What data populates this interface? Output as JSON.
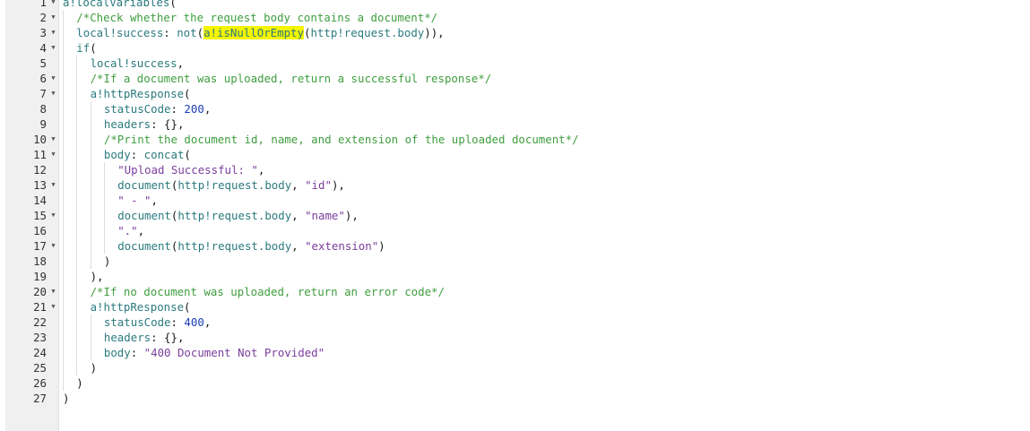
{
  "editor": {
    "lines": [
      {
        "num": "1",
        "fold": true,
        "indent": 0,
        "tokens": [
          {
            "t": "k",
            "v": "a!localVariables"
          },
          {
            "t": "p",
            "v": "("
          }
        ]
      },
      {
        "num": "2",
        "fold": true,
        "indent": 1,
        "tokens": [
          {
            "t": "c",
            "v": "/*Check whether the request body contains a document*/"
          }
        ]
      },
      {
        "num": "3",
        "fold": true,
        "indent": 1,
        "tokens": [
          {
            "t": "k",
            "v": "local!success"
          },
          {
            "t": "p",
            "v": ": "
          },
          {
            "t": "k",
            "v": "not"
          },
          {
            "t": "p",
            "v": "("
          },
          {
            "t": "k",
            "v": "a!isNullOrEmpty",
            "hl": true
          },
          {
            "t": "p",
            "v": "("
          },
          {
            "t": "k",
            "v": "http!request.body"
          },
          {
            "t": "p",
            "v": ")),"
          }
        ]
      },
      {
        "num": "4",
        "fold": true,
        "indent": 1,
        "tokens": [
          {
            "t": "k",
            "v": "if"
          },
          {
            "t": "p",
            "v": "("
          }
        ]
      },
      {
        "num": "5",
        "fold": false,
        "indent": 2,
        "tokens": [
          {
            "t": "k",
            "v": "local!success"
          },
          {
            "t": "p",
            "v": ","
          }
        ]
      },
      {
        "num": "6",
        "fold": true,
        "indent": 2,
        "tokens": [
          {
            "t": "c",
            "v": "/*If a document was uploaded, return a successful response*/"
          }
        ]
      },
      {
        "num": "7",
        "fold": true,
        "indent": 2,
        "tokens": [
          {
            "t": "k",
            "v": "a!httpResponse"
          },
          {
            "t": "p",
            "v": "("
          }
        ]
      },
      {
        "num": "8",
        "fold": false,
        "indent": 3,
        "tokens": [
          {
            "t": "k",
            "v": "statusCode"
          },
          {
            "t": "p",
            "v": ": "
          },
          {
            "t": "n",
            "v": "200"
          },
          {
            "t": "p",
            "v": ","
          }
        ]
      },
      {
        "num": "9",
        "fold": false,
        "indent": 3,
        "tokens": [
          {
            "t": "k",
            "v": "headers"
          },
          {
            "t": "p",
            "v": ": {},"
          }
        ]
      },
      {
        "num": "10",
        "fold": true,
        "indent": 3,
        "tokens": [
          {
            "t": "c",
            "v": "/*Print the document id, name, and extension of the uploaded document*/"
          }
        ]
      },
      {
        "num": "11",
        "fold": true,
        "indent": 3,
        "tokens": [
          {
            "t": "k",
            "v": "body"
          },
          {
            "t": "p",
            "v": ": "
          },
          {
            "t": "k",
            "v": "concat"
          },
          {
            "t": "p",
            "v": "("
          }
        ]
      },
      {
        "num": "12",
        "fold": false,
        "indent": 4,
        "tokens": [
          {
            "t": "s",
            "v": "\"Upload Successful: \""
          },
          {
            "t": "p",
            "v": ","
          }
        ]
      },
      {
        "num": "13",
        "fold": true,
        "indent": 4,
        "tokens": [
          {
            "t": "k",
            "v": "document"
          },
          {
            "t": "p",
            "v": "("
          },
          {
            "t": "k",
            "v": "http!request.body"
          },
          {
            "t": "p",
            "v": ", "
          },
          {
            "t": "s",
            "v": "\"id\""
          },
          {
            "t": "p",
            "v": "),"
          }
        ]
      },
      {
        "num": "14",
        "fold": false,
        "indent": 4,
        "tokens": [
          {
            "t": "s",
            "v": "\" - \""
          },
          {
            "t": "p",
            "v": ","
          }
        ]
      },
      {
        "num": "15",
        "fold": true,
        "indent": 4,
        "tokens": [
          {
            "t": "k",
            "v": "document"
          },
          {
            "t": "p",
            "v": "("
          },
          {
            "t": "k",
            "v": "http!request.body"
          },
          {
            "t": "p",
            "v": ", "
          },
          {
            "t": "s",
            "v": "\"name\""
          },
          {
            "t": "p",
            "v": "),"
          }
        ]
      },
      {
        "num": "16",
        "fold": false,
        "indent": 4,
        "tokens": [
          {
            "t": "s",
            "v": "\".\""
          },
          {
            "t": "p",
            "v": ","
          }
        ]
      },
      {
        "num": "17",
        "fold": true,
        "indent": 4,
        "tokens": [
          {
            "t": "k",
            "v": "document"
          },
          {
            "t": "p",
            "v": "("
          },
          {
            "t": "k",
            "v": "http!request.body"
          },
          {
            "t": "p",
            "v": ", "
          },
          {
            "t": "s",
            "v": "\"extension\""
          },
          {
            "t": "p",
            "v": ")"
          }
        ]
      },
      {
        "num": "18",
        "fold": false,
        "indent": 3,
        "tokens": [
          {
            "t": "p",
            "v": ")"
          }
        ]
      },
      {
        "num": "19",
        "fold": false,
        "indent": 2,
        "tokens": [
          {
            "t": "p",
            "v": "),"
          }
        ]
      },
      {
        "num": "20",
        "fold": true,
        "indent": 2,
        "tokens": [
          {
            "t": "c",
            "v": "/*If no document was uploaded, return an error code*/"
          }
        ]
      },
      {
        "num": "21",
        "fold": true,
        "indent": 2,
        "tokens": [
          {
            "t": "k",
            "v": "a!httpResponse"
          },
          {
            "t": "p",
            "v": "("
          }
        ]
      },
      {
        "num": "22",
        "fold": false,
        "indent": 3,
        "tokens": [
          {
            "t": "k",
            "v": "statusCode"
          },
          {
            "t": "p",
            "v": ": "
          },
          {
            "t": "n",
            "v": "400"
          },
          {
            "t": "p",
            "v": ","
          }
        ]
      },
      {
        "num": "23",
        "fold": false,
        "indent": 3,
        "tokens": [
          {
            "t": "k",
            "v": "headers"
          },
          {
            "t": "p",
            "v": ": {},"
          }
        ]
      },
      {
        "num": "24",
        "fold": false,
        "indent": 3,
        "tokens": [
          {
            "t": "k",
            "v": "body"
          },
          {
            "t": "p",
            "v": ": "
          },
          {
            "t": "s",
            "v": "\"400 Document Not Provided\""
          }
        ]
      },
      {
        "num": "25",
        "fold": false,
        "indent": 2,
        "tokens": [
          {
            "t": "p",
            "v": ")"
          }
        ]
      },
      {
        "num": "26",
        "fold": false,
        "indent": 1,
        "tokens": [
          {
            "t": "p",
            "v": ")"
          }
        ]
      },
      {
        "num": "27",
        "fold": false,
        "indent": 0,
        "tokens": [
          {
            "t": "p",
            "v": ")"
          }
        ]
      }
    ]
  },
  "colors": {
    "gutter_bg": "#f0f0f0",
    "function": "#2b7a7e",
    "string": "#7a3e9d",
    "number": "#1a3db8",
    "comment": "#3f9e3f",
    "highlight": "#f5f500"
  }
}
